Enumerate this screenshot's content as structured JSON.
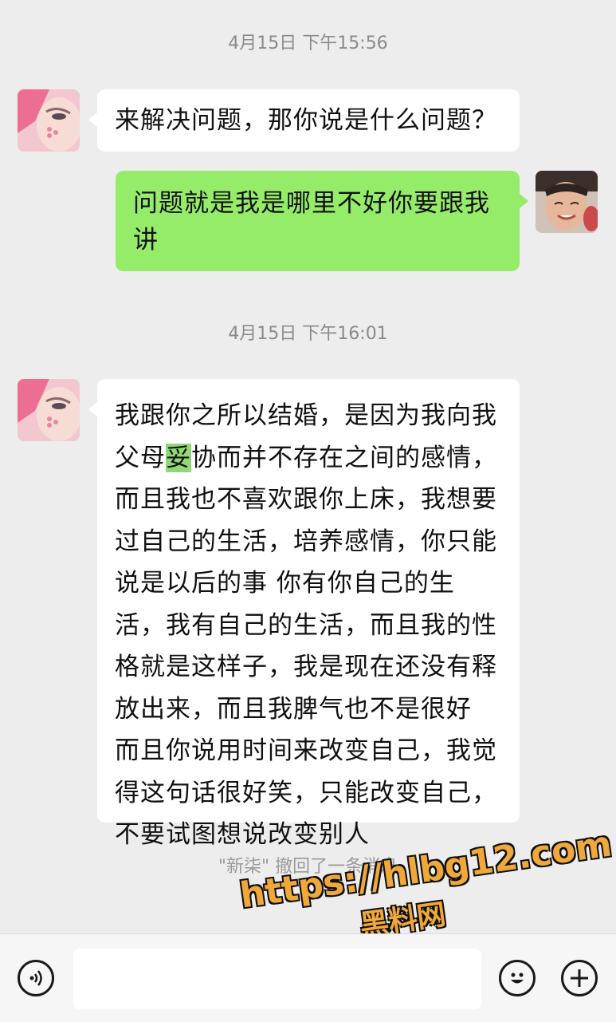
{
  "messages": {
    "ts1": "4月15日 下午15:56",
    "msg1": "来解决问题，那你说是什么问题？",
    "msg2": "问题就是我是哪里不好你要跟我讲",
    "ts2": "4月15日 下午16:01",
    "msg3": {
      "before": "我跟你之所以结婚，是因为我向我父母",
      "highlight": "妥",
      "after": "协而并不存在之间的感情，而且我也不喜欢跟你上床，我想要过自己的生活，培养感情，你只能说是以后的事 你有你自己的生活，我有自己的生活，而且我的性格就是这样子，我是现在还没有释放出来，而且我脾气也不是很好 而且你说用时间来改变自己，我觉得这句话很好笑，只能改变自己，不要试图想说改变别人"
    },
    "system": "\"新柒\" 撤回了一条消息"
  },
  "watermark": {
    "url": "https://hlbg12.com",
    "name": "黑料网"
  },
  "bottombar": {
    "input_placeholder": "",
    "voice_icon": "voice-icon",
    "emoji_icon": "emoji-icon",
    "plus_icon": "plus-icon"
  },
  "colors": {
    "background": "#ededed",
    "bubble_left": "#ffffff",
    "bubble_right": "#95ec69",
    "watermark": "#f0a83a"
  }
}
